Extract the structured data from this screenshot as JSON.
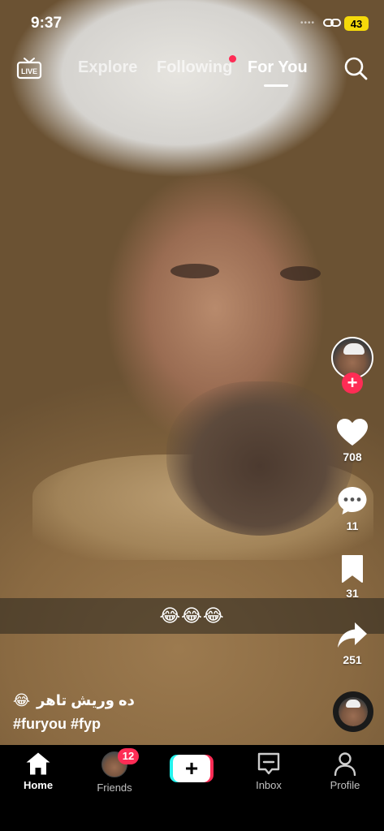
{
  "status_bar": {
    "time": "9:37",
    "dots": "••••",
    "battery": "43"
  },
  "top_nav": {
    "live_label": "LIVE",
    "tabs": [
      {
        "label": "Explore"
      },
      {
        "label": "Following"
      },
      {
        "label": "For You"
      }
    ]
  },
  "video": {
    "caption_overlay": "😂😂😂"
  },
  "actions": {
    "likes": "708",
    "comments": "11",
    "saves": "31",
    "shares": "251"
  },
  "description": {
    "text": "ده وریش تاهر",
    "emoji": "😂",
    "hashtags": "#furyou #fyp"
  },
  "bottom_nav": {
    "home": "Home",
    "friends": "Friends",
    "friends_badge": "12",
    "create": "+",
    "inbox": "Inbox",
    "profile": "Profile"
  },
  "colors": {
    "accent": "#fe2c55",
    "cyan": "#25f4ee",
    "battery": "#f5d90a"
  }
}
